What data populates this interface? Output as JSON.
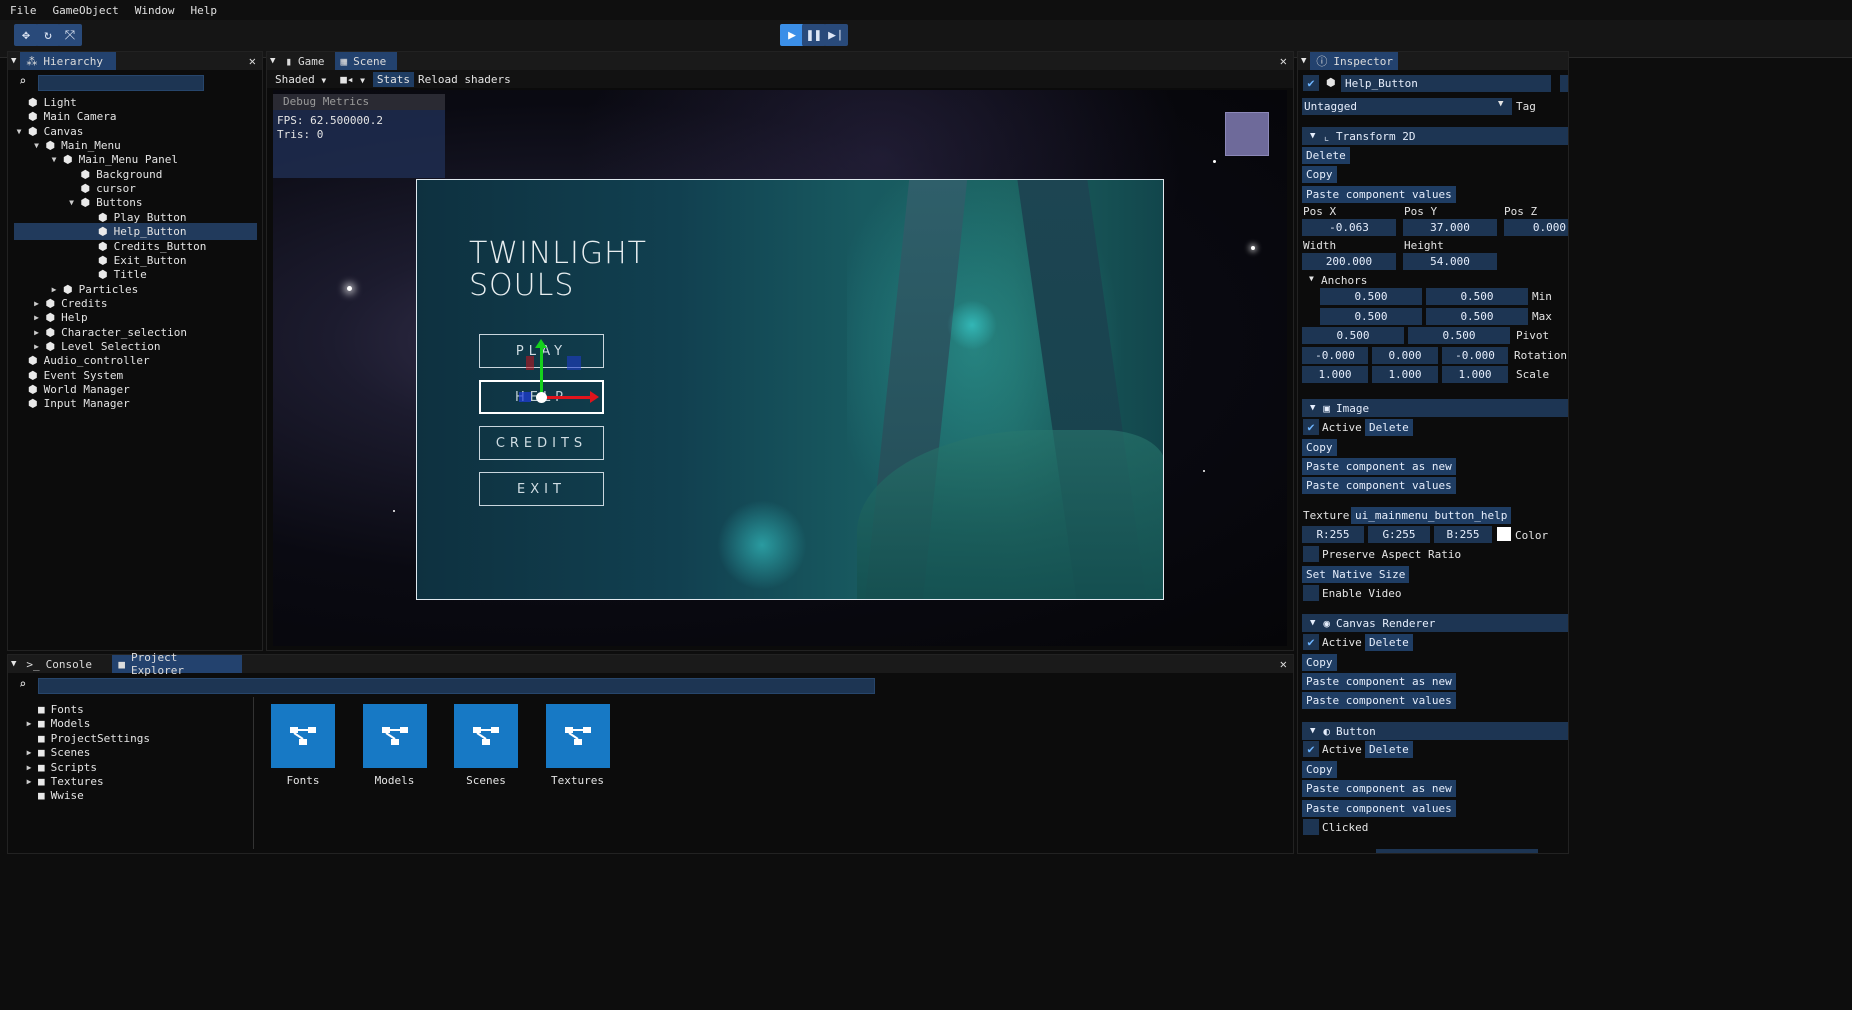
{
  "menu": [
    "File",
    "GameObject",
    "Window",
    "Help"
  ],
  "toolbar": {
    "left_icons": [
      "move-icon",
      "rotate-icon",
      "scale-icon"
    ],
    "play_icons": [
      "play-icon",
      "pause-icon",
      "step-icon"
    ]
  },
  "hierarchy": {
    "tab": "Hierarchy",
    "items": [
      {
        "label": "Light",
        "depth": 0,
        "arrow": ""
      },
      {
        "label": "Main Camera",
        "depth": 0,
        "arrow": ""
      },
      {
        "label": "Canvas",
        "depth": 0,
        "arrow": "open"
      },
      {
        "label": "Main_Menu",
        "depth": 1,
        "arrow": "open"
      },
      {
        "label": "Main_Menu Panel",
        "depth": 2,
        "arrow": "open"
      },
      {
        "label": "Background",
        "depth": 3,
        "arrow": ""
      },
      {
        "label": "cursor",
        "depth": 3,
        "arrow": ""
      },
      {
        "label": "Buttons",
        "depth": 3,
        "arrow": "open"
      },
      {
        "label": "Play_Button",
        "depth": 4,
        "arrow": ""
      },
      {
        "label": "Help_Button",
        "depth": 4,
        "arrow": "",
        "selected": true
      },
      {
        "label": "Credits_Button",
        "depth": 4,
        "arrow": ""
      },
      {
        "label": "Exit_Button",
        "depth": 4,
        "arrow": ""
      },
      {
        "label": "Title",
        "depth": 4,
        "arrow": ""
      },
      {
        "label": "Particles",
        "depth": 2,
        "arrow": "closed"
      },
      {
        "label": "Credits",
        "depth": 1,
        "arrow": "closed"
      },
      {
        "label": "Help",
        "depth": 1,
        "arrow": "closed"
      },
      {
        "label": "Character_selection",
        "depth": 1,
        "arrow": "closed"
      },
      {
        "label": "Level Selection",
        "depth": 1,
        "arrow": "closed"
      },
      {
        "label": "Audio_controller",
        "depth": 0,
        "arrow": ""
      },
      {
        "label": "Event System",
        "depth": 0,
        "arrow": ""
      },
      {
        "label": "World Manager",
        "depth": 0,
        "arrow": ""
      },
      {
        "label": "Input Manager",
        "depth": 0,
        "arrow": ""
      }
    ]
  },
  "viewport": {
    "tabs": [
      "Game",
      "Scene"
    ],
    "shading": "Shaded",
    "stats": "Stats",
    "reload": "Reload shaders",
    "debug": {
      "title": "Debug Metrics",
      "fps": "FPS: 62.500000.2",
      "tris": "Tris: 0"
    },
    "game": {
      "title_line1": "TWINLIGHT",
      "title_line2": "SOULS",
      "buttons": [
        "PLAY",
        "HELP",
        "CREDITS",
        "EXIT"
      ]
    }
  },
  "bottom": {
    "tabs": [
      "Console",
      "Project Explorer"
    ],
    "tree": [
      {
        "label": "Fonts",
        "arrow": ""
      },
      {
        "label": "Models",
        "arrow": "closed"
      },
      {
        "label": "ProjectSettings",
        "arrow": ""
      },
      {
        "label": "Scenes",
        "arrow": "closed"
      },
      {
        "label": "Scripts",
        "arrow": "closed"
      },
      {
        "label": "Textures",
        "arrow": "closed"
      },
      {
        "label": "Wwise",
        "arrow": ""
      }
    ],
    "folders": [
      "Fonts",
      "Models",
      "Scenes",
      "Textures"
    ]
  },
  "inspector": {
    "tab": "Inspector",
    "object_name": "Help_Button",
    "tag_value": "Untagged",
    "tag_label": "Tag",
    "transform": {
      "title": "Transform 2D",
      "delete": "Delete",
      "copy": "Copy",
      "paste_values": "Paste component values",
      "pos_x_label": "Pos X",
      "pos_y_label": "Pos Y",
      "pos_z_label": "Pos Z",
      "pos_x": "-0.063",
      "pos_y": "37.000",
      "pos_z": "0.000",
      "width_label": "Width",
      "height_label": "Height",
      "width": "200.000",
      "height": "54.000",
      "anchors_label": "Anchors",
      "min": [
        "0.500",
        "0.500"
      ],
      "min_label": "Min",
      "max": [
        "0.500",
        "0.500"
      ],
      "max_label": "Max",
      "pivot": [
        "0.500",
        "0.500"
      ],
      "pivot_label": "Pivot",
      "rotation": [
        "-0.000",
        "0.000",
        "-0.000"
      ],
      "rotation_label": "Rotation",
      "scale": [
        "1.000",
        "1.000",
        "1.000"
      ],
      "scale_label": "Scale"
    },
    "image": {
      "title": "Image",
      "active": "Active",
      "delete": "Delete",
      "copy": "Copy",
      "paste_new": "Paste component as new",
      "paste_values": "Paste component values",
      "texture_label": "Texture",
      "texture": "ui_mainmenu_button_help",
      "r": "R:255",
      "g": "G:255",
      "b": "B:255",
      "color_label": "Color",
      "preserve": "Preserve Aspect Ratio",
      "native": "Set Native Size",
      "video": "Enable Video"
    },
    "canvas_renderer": {
      "title": "Canvas Renderer",
      "active": "Active",
      "delete": "Delete",
      "copy": "Copy",
      "paste_new": "Paste component as new",
      "paste_values": "Paste component values"
    },
    "button": {
      "title": "Button",
      "active": "Active",
      "delete": "Delete",
      "copy": "Copy",
      "paste_new": "Paste component as new",
      "paste_values": "Paste component values",
      "clicked": "Clicked"
    }
  },
  "colors": {
    "accent": "#23426e",
    "field": "#1d3553",
    "play": "#3b8fe8",
    "folder": "#1779c5"
  }
}
